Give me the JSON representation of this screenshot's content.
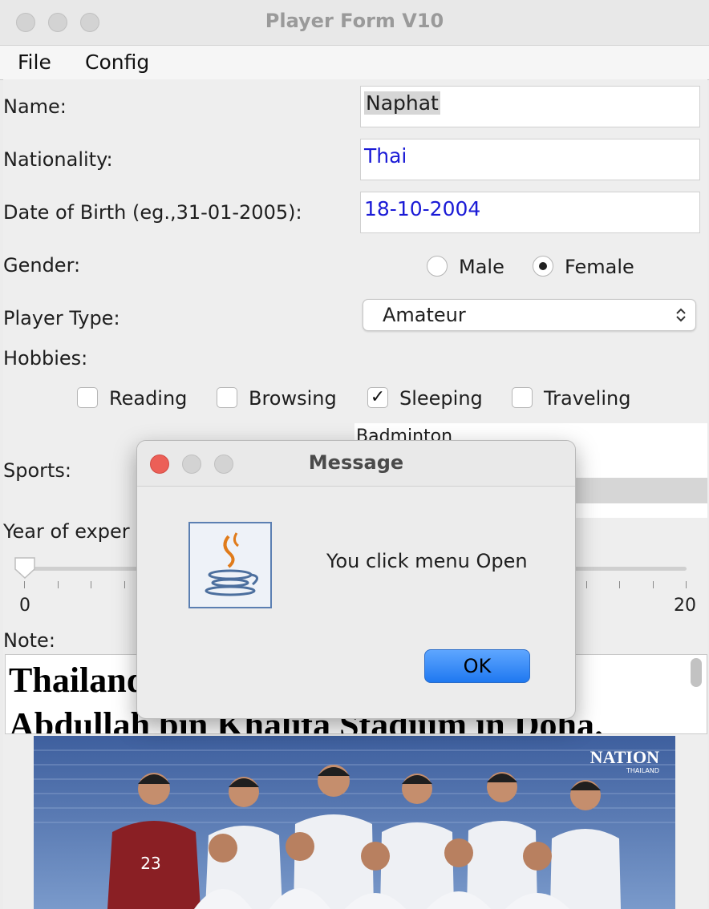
{
  "window": {
    "title": "Player Form V10"
  },
  "menu": {
    "file": "File",
    "config": "Config"
  },
  "form": {
    "name_label": "Name:",
    "name_value": "Naphat",
    "nationality_label": "Nationality:",
    "nationality_value": "Thai",
    "dob_label": "Date of Birth (eg.,31-01-2005):",
    "dob_value": "18-10-2004",
    "gender_label": "Gender:",
    "gender_options": [
      "Male",
      "Female"
    ],
    "gender_selected": "Female",
    "player_type_label": "Player Type:",
    "player_type_value": "Amateur",
    "hobbies_label": "Hobbies:",
    "hobbies": [
      {
        "label": "Reading",
        "checked": false
      },
      {
        "label": "Browsing",
        "checked": false
      },
      {
        "label": "Sleeping",
        "checked": true
      },
      {
        "label": "Traveling",
        "checked": false
      }
    ],
    "sports_label": "Sports:",
    "sports_visible_item": "Badminton",
    "experience_label": "Year of exper",
    "slider_min": "0",
    "slider_max": "20",
    "slider_value": 0,
    "note_label": "Note:",
    "note_text_line1": "Thailand",
    "note_text_line2": "Abdullah bin Khalifa Stadium in Doha."
  },
  "photo": {
    "watermark": "NATION",
    "watermark_sub": "THAILAND",
    "jersey_number": "23"
  },
  "dialog": {
    "title": "Message",
    "message": "You click menu Open",
    "ok_label": "OK",
    "icon": "java-coffee-cup-icon"
  },
  "colors": {
    "field_text_blue": "#1a1ad6",
    "selection_gray": "#d6d6d6",
    "ok_button": "#2d86f6",
    "close_red": "#ec5f57"
  }
}
